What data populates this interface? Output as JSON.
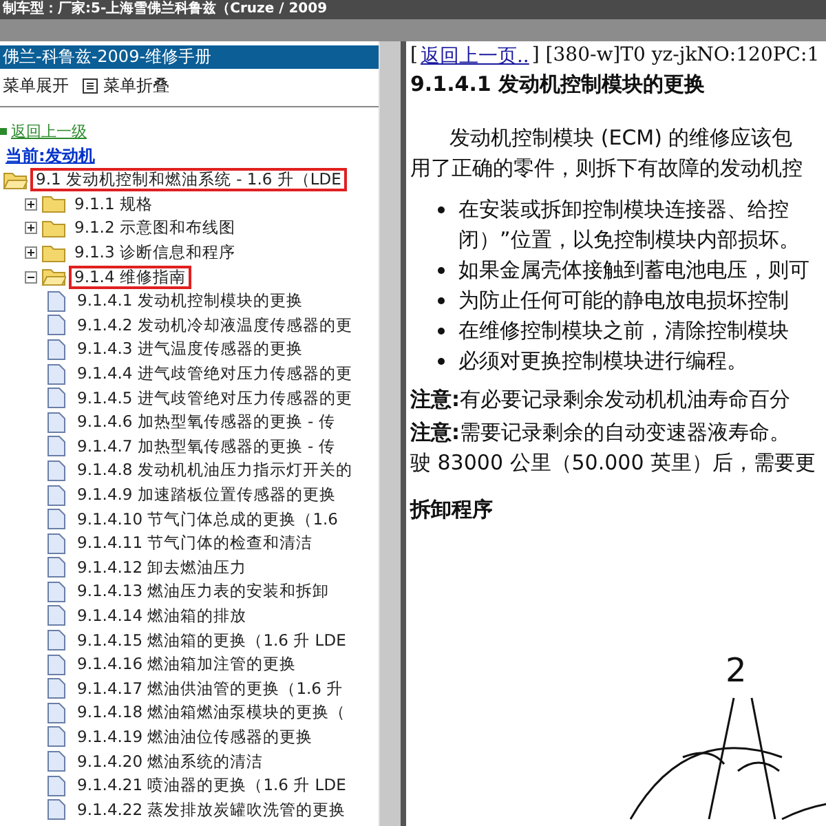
{
  "window": {
    "title": "制车型：厂家:5-上海雪佛兰科鲁兹（Cruze / 2009"
  },
  "sidebar": {
    "title": "佛兰-科鲁兹-2009-维修手册",
    "toolbar": [
      {
        "label": "菜单展开",
        "kind": "expand"
      },
      {
        "label": "菜单折叠",
        "kind": "collapse"
      }
    ],
    "back_link": "返回上一级",
    "current": "当前:发动机",
    "tree": [
      {
        "kind": "folder",
        "label": "9.1 发动机控制和燃油系统 - 1.6 升（LDE",
        "expanded": true,
        "highlighted": true,
        "children": [
          {
            "kind": "folder",
            "label": "9.1.1 规格",
            "expanded": false,
            "highlighted": false
          },
          {
            "kind": "folder",
            "label": "9.1.2 示意图和布线图",
            "expanded": false,
            "highlighted": false
          },
          {
            "kind": "folder",
            "label": "9.1.3 诊断信息和程序",
            "expanded": false,
            "highlighted": false
          },
          {
            "kind": "folder",
            "label": "9.1.4 维修指南",
            "expanded": true,
            "highlighted": true,
            "children": [
              {
                "label": "9.1.4.1 发动机控制模块的更换"
              },
              {
                "label": "9.1.4.2 发动机冷却液温度传感器的更"
              },
              {
                "label": "9.1.4.3 进气温度传感器的更换"
              },
              {
                "label": "9.1.4.4 进气歧管绝对压力传感器的更"
              },
              {
                "label": "9.1.4.5 进气歧管绝对压力传感器的更"
              },
              {
                "label": "9.1.4.6 加热型氧传感器的更换 - 传"
              },
              {
                "label": "9.1.4.7 加热型氧传感器的更换 - 传"
              },
              {
                "label": "9.1.4.8 发动机机油压力指示灯开关的"
              },
              {
                "label": "9.1.4.9 加速踏板位置传感器的更换"
              },
              {
                "label": "9.1.4.10 节气门体总成的更换（1.6"
              },
              {
                "label": "9.1.4.11 节气门体的检查和清洁"
              },
              {
                "label": "9.1.4.12 卸去燃油压力"
              },
              {
                "label": "9.1.4.13 燃油压力表的安装和拆卸"
              },
              {
                "label": "9.1.4.14 燃油箱的排放"
              },
              {
                "label": "9.1.4.15 燃油箱的更换（1.6 升 LDE"
              },
              {
                "label": "9.1.4.16 燃油箱加注管的更换"
              },
              {
                "label": "9.1.4.17 燃油供油管的更换（1.6 升"
              },
              {
                "label": "9.1.4.18 燃油箱燃油泵模块的更换（"
              },
              {
                "label": "9.1.4.19 燃油油位传感器的更换"
              },
              {
                "label": "9.1.4.20 燃油系统的清洁"
              },
              {
                "label": "9.1.4.21 喷油器的更换（1.6 升 LDE"
              },
              {
                "label": "9.1.4.22 蒸发排放炭罐吹洗管的更换"
              }
            ]
          }
        ]
      }
    ]
  },
  "content": {
    "open_bracket": "[",
    "back_link": "返回上一页..",
    "ref": "] [380-w]T0 yz-jkNO:120PC:1",
    "heading": "9.1.4.1 发动机控制模块的更换",
    "paragraph": [
      "发动机控制模块 (ECM) 的维修应该包",
      "用了正确的零件，则拆下有故障的发动机控"
    ],
    "bullets": [
      {
        "lines": [
          "在安装或拆卸控制模块连接器、给控",
          "闭）”位置，以免控制模块内部损坏。"
        ]
      },
      {
        "lines": [
          "如果金属壳体接触到蓄电池电压，则可"
        ]
      },
      {
        "lines": [
          "为防止任何可能的静电放电损坏控制"
        ]
      },
      {
        "lines": [
          "在维修控制模块之前，清除控制模块"
        ]
      },
      {
        "lines": [
          "必须对更换控制模块进行编程。"
        ]
      }
    ],
    "notes": [
      {
        "label": "注意:",
        "lines": [
          "有必要记录剩余发动机机油寿命百分"
        ]
      },
      {
        "label": "注意:",
        "lines": [
          "需要记录剩余的自动变速器液寿命。",
          "驶 83000 公里（50.000 英里）后，需要更"
        ]
      }
    ],
    "section": "拆卸程序",
    "figure_callout": "2"
  }
}
